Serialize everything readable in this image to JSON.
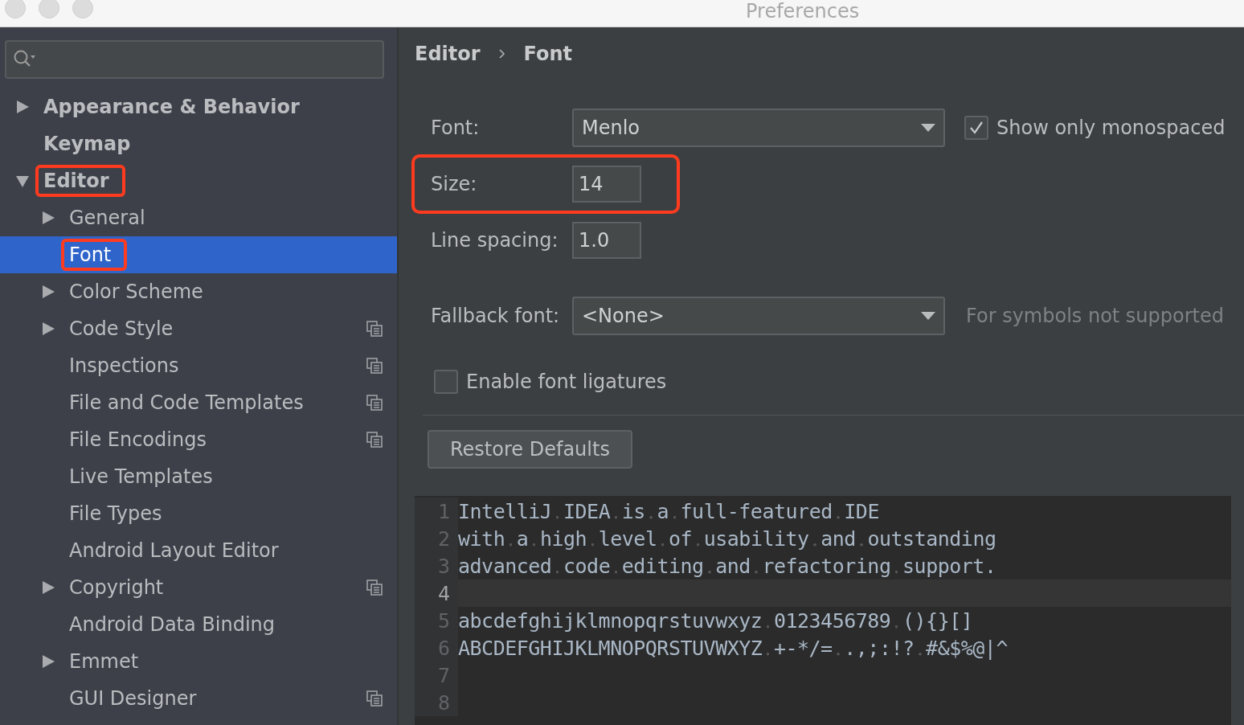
{
  "window": {
    "title": "Preferences"
  },
  "sidebar": {
    "items": [
      {
        "label": "Appearance & Behavior",
        "expanded": false,
        "selected": false,
        "annotated": false,
        "project_scope": false
      },
      {
        "label": "Keymap",
        "selected": false,
        "annotated": false,
        "project_scope": false
      },
      {
        "label": "Editor",
        "expanded": true,
        "selected": false,
        "annotated": true,
        "project_scope": false,
        "children": [
          {
            "label": "General",
            "expanded": false,
            "selected": false,
            "annotated": false,
            "project_scope": false
          },
          {
            "label": "Font",
            "selected": true,
            "annotated": true,
            "project_scope": false
          },
          {
            "label": "Color Scheme",
            "expanded": false,
            "selected": false,
            "annotated": false,
            "project_scope": false
          },
          {
            "label": "Code Style",
            "expanded": false,
            "selected": false,
            "annotated": false,
            "project_scope": true
          },
          {
            "label": "Inspections",
            "selected": false,
            "annotated": false,
            "project_scope": true
          },
          {
            "label": "File and Code Templates",
            "selected": false,
            "annotated": false,
            "project_scope": true
          },
          {
            "label": "File Encodings",
            "selected": false,
            "annotated": false,
            "project_scope": true
          },
          {
            "label": "Live Templates",
            "selected": false,
            "annotated": false,
            "project_scope": false
          },
          {
            "label": "File Types",
            "selected": false,
            "annotated": false,
            "project_scope": false
          },
          {
            "label": "Android Layout Editor",
            "selected": false,
            "annotated": false,
            "project_scope": false
          },
          {
            "label": "Copyright",
            "expanded": false,
            "selected": false,
            "annotated": false,
            "project_scope": true
          },
          {
            "label": "Android Data Binding",
            "selected": false,
            "annotated": false,
            "project_scope": false
          },
          {
            "label": "Emmet",
            "expanded": false,
            "selected": false,
            "annotated": false,
            "project_scope": false
          },
          {
            "label": "GUI Designer",
            "selected": false,
            "annotated": false,
            "project_scope": true
          }
        ]
      }
    ]
  },
  "breadcrumb": [
    "Editor",
    "Font"
  ],
  "font": {
    "label": "Font:",
    "value": "Menlo",
    "monospaced": {
      "label": "Show only monospaced",
      "checked": true
    }
  },
  "size": {
    "label": "Size:",
    "value": "14",
    "annotated": true
  },
  "line_spacing": {
    "label": "Line spacing:",
    "value": "1.0"
  },
  "fallback": {
    "label": "Fallback font:",
    "value": "<None>",
    "hint": "For symbols not supported"
  },
  "ligatures": {
    "label": "Enable font ligatures",
    "checked": false
  },
  "restore_button": "Restore Defaults",
  "preview": {
    "lines": [
      {
        "number": "1",
        "text": "IntelliJ IDEA is a full-featured IDE",
        "current": false
      },
      {
        "number": "2",
        "text": "with a high level of usability and outstanding",
        "current": false
      },
      {
        "number": "3",
        "text": "advanced code editing and refactoring support.",
        "current": false
      },
      {
        "number": "4",
        "current": true
      },
      {
        "number": "5",
        "text": "abcdefghijklmnopqrstuvwxyz 0123456789 (){}[]",
        "current": false
      },
      {
        "number": "6",
        "text": "ABCDEFGHIJKLMNOPQRSTUVWXYZ +-*/= .,;:!? #&$%@|^",
        "current": false
      },
      {
        "number": "7",
        "current": false
      },
      {
        "number": "8",
        "current": false
      }
    ]
  }
}
